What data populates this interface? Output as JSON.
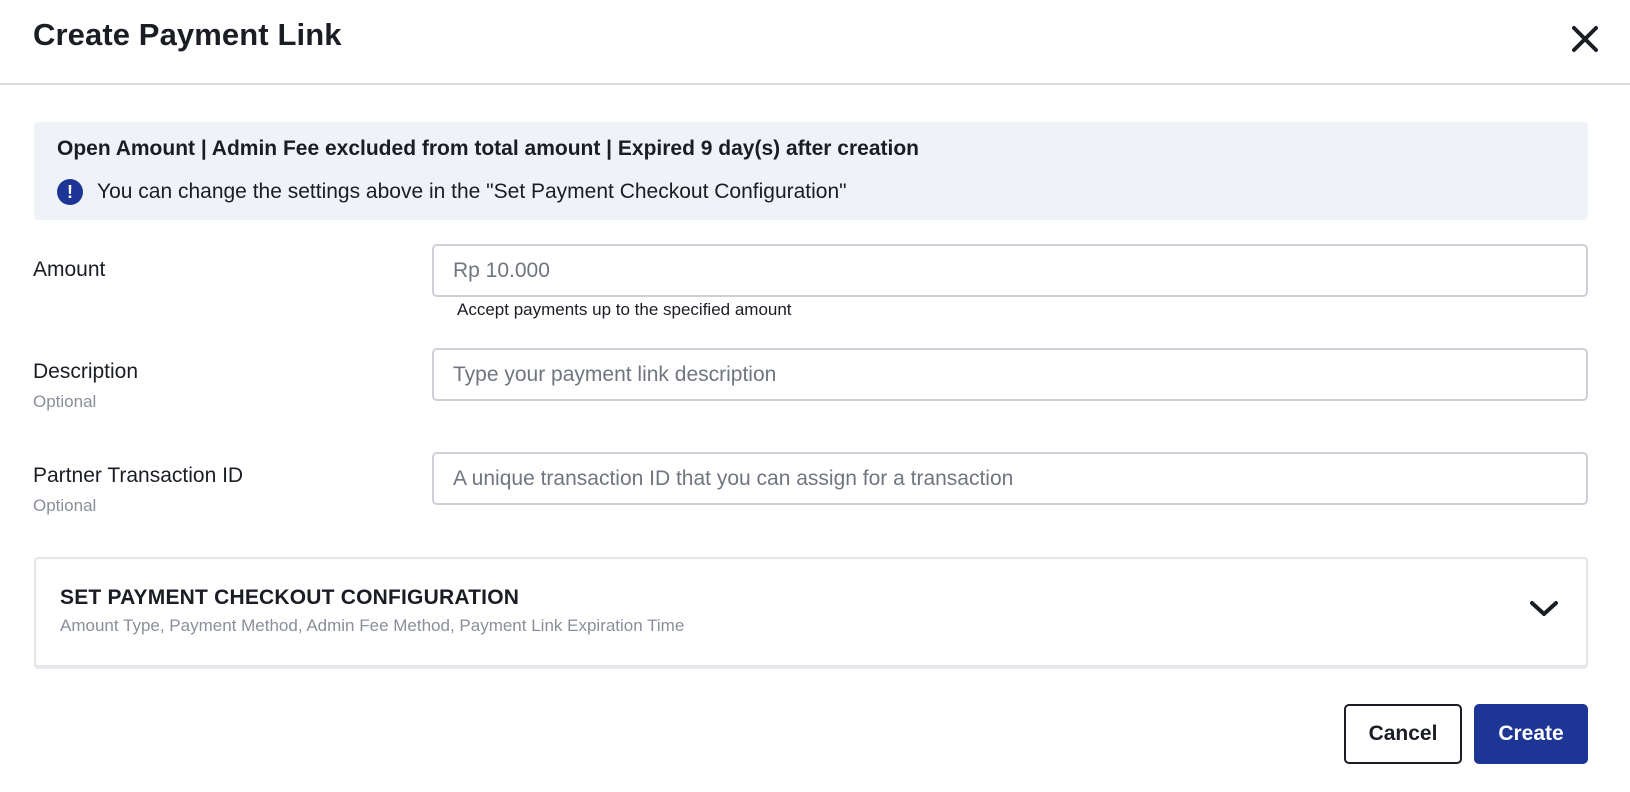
{
  "dialog": {
    "title": "Create Payment Link"
  },
  "info": {
    "summary": "Open Amount | Admin Fee excluded from total amount | Expired 9 day(s) after creation",
    "icon": "exclamation-icon",
    "note": "You can change the settings above in the \"Set Payment Checkout Configuration\""
  },
  "fields": {
    "amount": {
      "label": "Amount",
      "placeholder": "Rp 10.000",
      "helper": "Accept payments up to the specified amount"
    },
    "description": {
      "label": "Description",
      "optional": "Optional",
      "placeholder": "Type your payment link description"
    },
    "partner_id": {
      "label": "Partner Transaction ID",
      "optional": "Optional",
      "placeholder": "A unique transaction ID that you can assign for a transaction"
    }
  },
  "config": {
    "title": "SET PAYMENT CHECKOUT CONFIGURATION",
    "subtitle": "Amount Type, Payment Method, Admin Fee Method, Payment Link Expiration Time",
    "icon": "chevron-down-icon"
  },
  "actions": {
    "cancel_label": "Cancel",
    "create_label": "Create"
  },
  "colors": {
    "primary": "#1d3594",
    "info_background": "#eff2f7",
    "text": "#1a1d24",
    "muted": "#8a8f99",
    "border": "#cdd0d6"
  }
}
